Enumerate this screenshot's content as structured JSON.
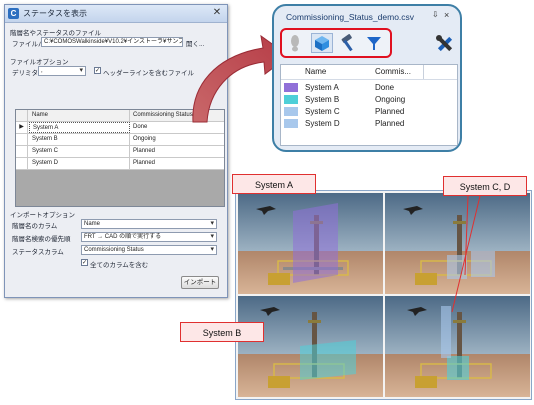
{
  "dialog": {
    "title": "ステータスを表示",
    "section_file_label": "階層名やステータスのファイル",
    "file_path_label": "ファイルパス",
    "file_path_value": "C:¥COMOSWalkinside¥V10.2¥インストーラ¥サンプル",
    "open_button_label": "開く...",
    "file_options_label": "ファイルオプション",
    "delimiter_label": "デリミター",
    "delimiter_value": ",",
    "header_checkbox_label": "ヘッダーラインを含むファイル",
    "header_checked": true,
    "grid_headers": [
      "Name",
      "Commissioning Status"
    ],
    "grid_rows": [
      {
        "name": "System A",
        "status": "Done"
      },
      {
        "name": "System B",
        "status": "Ongoing"
      },
      {
        "name": "System C",
        "status": "Planned"
      },
      {
        "name": "System D",
        "status": "Planned"
      }
    ],
    "current_row_marker": "▶",
    "import_options_label": "インポートオプション",
    "name_column_label": "階層名のカラム",
    "name_column_value": "Name",
    "search_priority_label": "階層名検索の優先順",
    "search_priority_value": "FRT → CAD の順で実行する",
    "status_column_label": "ステータスカラム",
    "status_column_value": "Commissioning Status",
    "all_columns_label": "全てのカラムを含む",
    "all_columns_checked": true,
    "import_button_label": "インポート"
  },
  "panel": {
    "title": "Commissioning_Status_demo.csv",
    "pin_glyph": "⇩",
    "close_glyph": "×",
    "col_name": "Name",
    "col_status": "Commis...",
    "rows": [
      {
        "name": "System A",
        "status": "Done",
        "color": "#9070d8"
      },
      {
        "name": "System B",
        "status": "Ongoing",
        "color": "#4ecfd8"
      },
      {
        "name": "System C",
        "status": "Planned",
        "color": "#a8c8ec"
      },
      {
        "name": "System D",
        "status": "Planned",
        "color": "#a8c8ec"
      }
    ],
    "icons": [
      "footprint-icon",
      "cube-icon",
      "hammer-icon",
      "filter-icon",
      "tools-icon"
    ]
  },
  "callouts": {
    "system_a": "System A",
    "system_cd": "System C, D",
    "system_b": "System B"
  },
  "colors": {
    "done": "#9070d8",
    "ongoing": "#4ecfd8",
    "planned": "#a8c8ec",
    "highlight_border": "#e01020",
    "panel_border": "#3e7fa6"
  }
}
